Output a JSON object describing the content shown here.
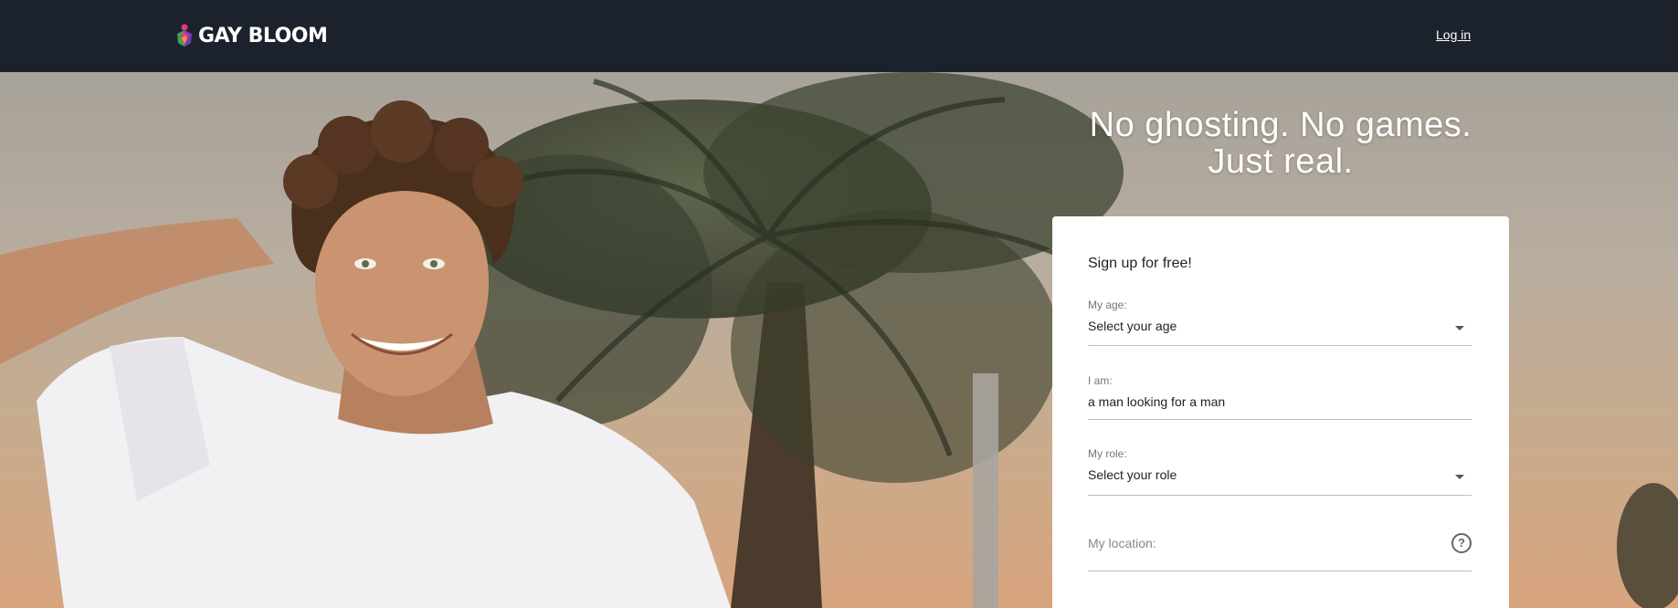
{
  "header": {
    "brand": "GAY BLOOM",
    "login_label": "Log in"
  },
  "hero": {
    "headline_line1": "No ghosting. No games.",
    "headline_line2": "Just real."
  },
  "signup": {
    "title": "Sign up for free!",
    "age": {
      "label": "My age:",
      "value": "Select your age"
    },
    "identity": {
      "label": "I am:",
      "value": "a man looking for a man"
    },
    "role": {
      "label": "My role:",
      "value": "Select your role"
    },
    "location": {
      "placeholder": "My location:",
      "help_icon": "question-icon"
    }
  },
  "colors": {
    "topbar": "#1c222b",
    "card": "#ffffff",
    "logo_pink": "#e8338b",
    "logo_green": "#3aa655",
    "logo_purple": "#6a3fb5"
  }
}
